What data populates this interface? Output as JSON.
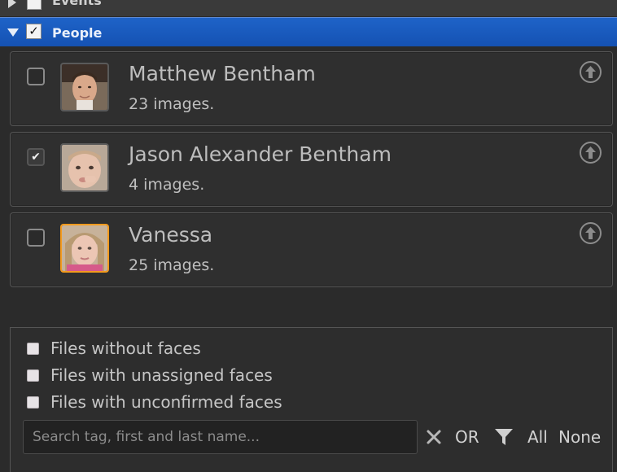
{
  "tree": {
    "events_label": "Events",
    "people_label": "People",
    "people_checked": true
  },
  "people": [
    {
      "name": "Matthew Bentham",
      "count": "23 images.",
      "checked": false,
      "highlighted": false
    },
    {
      "name": "Jason Alexander Bentham",
      "count": "4 images.",
      "checked": true,
      "highlighted": false
    },
    {
      "name": "Vanessa",
      "count": "25 images.",
      "checked": false,
      "highlighted": true
    }
  ],
  "filters": {
    "without_faces": "Files without faces",
    "unassigned_faces": "Files with unassigned faces",
    "unconfirmed_faces": "Files with unconfirmed faces"
  },
  "search": {
    "placeholder": "Search tag, first and last name...",
    "value": ""
  },
  "toolbar": {
    "or_label": "OR",
    "all_label": "All",
    "none_label": "None"
  },
  "colors": {
    "selection_blue": "#1e63c8",
    "highlight_orange": "#f39a1e",
    "panel": "#2b2b2b"
  }
}
